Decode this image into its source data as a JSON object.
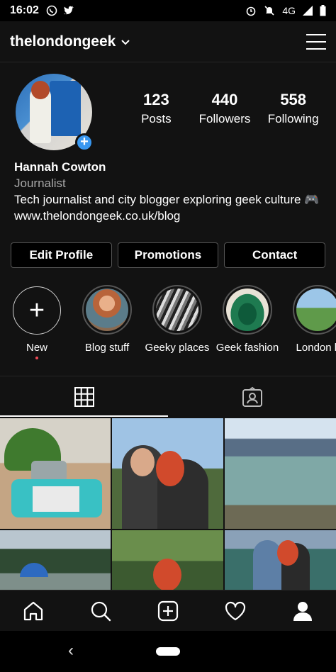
{
  "status_bar": {
    "time": "16:02",
    "network": "4G"
  },
  "header": {
    "username": "thelondongeek"
  },
  "profile": {
    "posts": {
      "count": "123",
      "label": "Posts"
    },
    "followers": {
      "count": "440",
      "label": "Followers"
    },
    "following": {
      "count": "558",
      "label": "Following"
    },
    "name": "Hannah Cowton",
    "category": "Journalist",
    "bio": "Tech journalist and city blogger exploring geek culture 🎮",
    "link": "www.thelondongeek.co.uk/blog"
  },
  "actions": {
    "edit_profile": "Edit Profile",
    "promotions": "Promotions",
    "contact": "Contact"
  },
  "highlights": [
    {
      "label": "New"
    },
    {
      "label": "Blog stuff"
    },
    {
      "label": "Geeky places"
    },
    {
      "label": "Geek fashion"
    },
    {
      "label": "London li"
    }
  ],
  "colors": {
    "accent": "#3897f0",
    "background": "#121212",
    "notification_dot": "#ed4956"
  },
  "icons": {
    "status": [
      "whatsapp-icon",
      "twitter-icon",
      "alarm-icon",
      "mute-icon",
      "signal-icon",
      "battery-icon"
    ],
    "tabs": [
      "grid-icon",
      "tagged-icon"
    ],
    "nav": [
      "home-icon",
      "search-icon",
      "add-post-icon",
      "heart-icon",
      "profile-icon"
    ]
  }
}
